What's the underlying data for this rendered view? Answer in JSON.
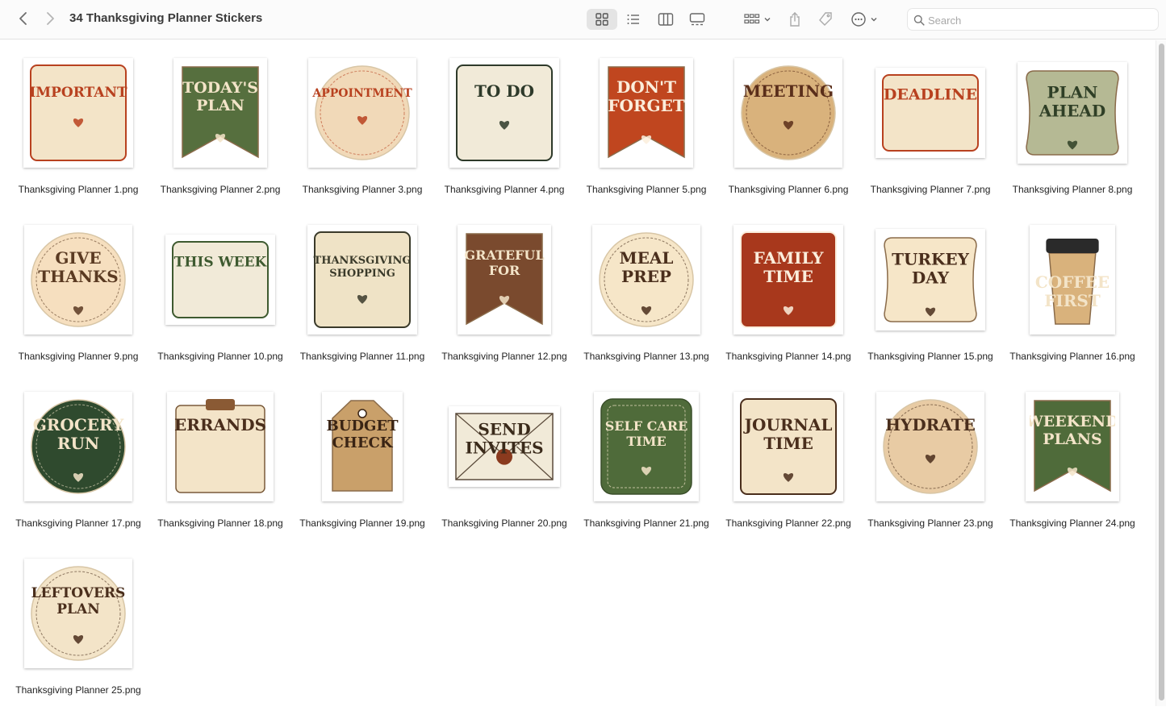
{
  "window": {
    "title": "34 Thanksgiving Planner Stickers"
  },
  "search": {
    "placeholder": "Search"
  },
  "colors": {
    "cream": "#f3e4c8",
    "green": "#4f6b3a",
    "rust": "#b8411f",
    "brown": "#7a4a2e",
    "tan": "#c9a06a",
    "sage": "#a7b08a"
  },
  "files": [
    {
      "name": "Thanksgiving Planner 1.png",
      "lines": [
        "IMPORTANT"
      ],
      "shape": "square",
      "bg": "#f3e4c8",
      "fg": "#b8411f"
    },
    {
      "name": "Thanksgiving Planner 2.png",
      "lines": [
        "TODAY'S",
        "PLAN"
      ],
      "shape": "banner",
      "bg": "#566f3e",
      "fg": "#f3e4c8"
    },
    {
      "name": "Thanksgiving Planner 3.png",
      "lines": [
        "APPOINTMENT"
      ],
      "shape": "circle",
      "bg": "#f1d9b8",
      "fg": "#b8411f"
    },
    {
      "name": "Thanksgiving Planner 4.png",
      "lines": [
        "TO DO"
      ],
      "shape": "square",
      "bg": "#f1ead8",
      "fg": "#2e3a2a"
    },
    {
      "name": "Thanksgiving Planner 5.png",
      "lines": [
        "DON'T",
        "FORGET"
      ],
      "shape": "banner",
      "bg": "#c0461f",
      "fg": "#fbeedc"
    },
    {
      "name": "Thanksgiving Planner 6.png",
      "lines": [
        "MEETING"
      ],
      "shape": "circle",
      "bg": "#d9b27c",
      "fg": "#5a2e1a"
    },
    {
      "name": "Thanksgiving Planner 7.png",
      "lines": [
        "DEADLINE"
      ],
      "shape": "wide",
      "bg": "#f3e4c8",
      "fg": "#b8411f"
    },
    {
      "name": "Thanksgiving Planner 8.png",
      "lines": [
        "PLAN",
        "AHEAD"
      ],
      "shape": "badge",
      "bg": "#b5b994",
      "fg": "#2f3f26"
    },
    {
      "name": "Thanksgiving Planner 9.png",
      "lines": [
        "GIVE",
        "THANKS"
      ],
      "shape": "circle",
      "bg": "#f6dfbf",
      "fg": "#5a3a22"
    },
    {
      "name": "Thanksgiving Planner 10.png",
      "lines": [
        "THIS WEEK"
      ],
      "shape": "wide",
      "bg": "#f1ead8",
      "fg": "#3e5a30"
    },
    {
      "name": "Thanksgiving Planner 11.png",
      "lines": [
        "THANKSGIVING",
        "SHOPPING"
      ],
      "shape": "square",
      "bg": "#efe3c6",
      "fg": "#3a3a2a"
    },
    {
      "name": "Thanksgiving Planner 12.png",
      "lines": [
        "GRATEFUL",
        "FOR"
      ],
      "shape": "banner",
      "bg": "#7a4a2e",
      "fg": "#f3e4c8"
    },
    {
      "name": "Thanksgiving Planner 13.png",
      "lines": [
        "MEAL",
        "PREP"
      ],
      "shape": "circle",
      "bg": "#f6e6c8",
      "fg": "#4a2e1c"
    },
    {
      "name": "Thanksgiving Planner 14.png",
      "lines": [
        "FAMILY",
        "TIME"
      ],
      "shape": "square",
      "bg": "#a8381c",
      "fg": "#fbeedc"
    },
    {
      "name": "Thanksgiving Planner 15.png",
      "lines": [
        "TURKEY",
        "DAY"
      ],
      "shape": "badge",
      "bg": "#f6e6c8",
      "fg": "#4a2e1c"
    },
    {
      "name": "Thanksgiving Planner 16.png",
      "lines": [
        "COFFEE",
        "FIRST"
      ],
      "shape": "cup",
      "bg": "#d9b27c",
      "fg": "#f3e4c8"
    },
    {
      "name": "Thanksgiving Planner 17.png",
      "lines": [
        "GROCERY",
        "RUN"
      ],
      "shape": "circle",
      "bg": "#2f4a2e",
      "fg": "#f3e4c8"
    },
    {
      "name": "Thanksgiving Planner 18.png",
      "lines": [
        "ERRANDS"
      ],
      "shape": "clip",
      "bg": "#f3e4c8",
      "fg": "#4a2e1c"
    },
    {
      "name": "Thanksgiving Planner 19.png",
      "lines": [
        "BUDGET",
        "CHECK"
      ],
      "shape": "tag",
      "bg": "#c9a06a",
      "fg": "#3a2414"
    },
    {
      "name": "Thanksgiving Planner 20.png",
      "lines": [
        "SEND",
        "INVITES"
      ],
      "shape": "envelope",
      "bg": "#f1ead8",
      "fg": "#3a2a1a"
    },
    {
      "name": "Thanksgiving Planner 21.png",
      "lines": [
        "SELF CARE",
        "TIME"
      ],
      "shape": "scallop",
      "bg": "#4f6b3a",
      "fg": "#f3e4c8"
    },
    {
      "name": "Thanksgiving Planner 22.png",
      "lines": [
        "JOURNAL",
        "TIME"
      ],
      "shape": "square",
      "bg": "#f3e4c8",
      "fg": "#4a2e1c"
    },
    {
      "name": "Thanksgiving Planner 23.png",
      "lines": [
        "HYDRATE"
      ],
      "shape": "circle",
      "bg": "#e8cba4",
      "fg": "#4a2e1c"
    },
    {
      "name": "Thanksgiving Planner 24.png",
      "lines": [
        "WEEKEND",
        "PLANS"
      ],
      "shape": "banner",
      "bg": "#4f6b3a",
      "fg": "#f3e4c8"
    },
    {
      "name": "Thanksgiving Planner 25.png",
      "lines": [
        "LEFTOVERS",
        "PLAN"
      ],
      "shape": "circle",
      "bg": "#f3e4c8",
      "fg": "#4a2e1c"
    }
  ]
}
